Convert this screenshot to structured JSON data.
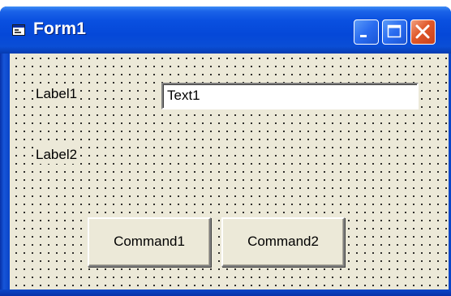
{
  "window": {
    "title": "Form1",
    "app_icon": "form-icon",
    "controls": [
      "minimize-icon",
      "maximize-icon",
      "close-icon"
    ]
  },
  "form": {
    "label1": "Label1",
    "label2": "Label2",
    "text1_value": "Text1",
    "command1_label": "Command1",
    "command2_label": "Command2"
  },
  "colors": {
    "titlebar": "#0a50e0",
    "close_button": "#e0582a",
    "client_background": "#ece9d8"
  }
}
